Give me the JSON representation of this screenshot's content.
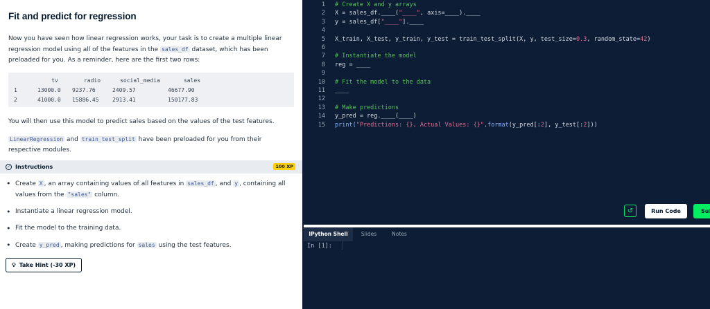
{
  "exercise": {
    "title": "Fit and predict for regression",
    "intro_before_code": "Now you have seen how linear regression works, your task is to create a multiple linear regression model using all of the features in the ",
    "intro_code": "sales_df",
    "intro_after_code": " dataset, which has been preloaded for you. As a reminder, here are the first two rows:",
    "table": {
      "headers": [
        "",
        "tv",
        "radio",
        "social_media",
        "sales"
      ],
      "rows": [
        [
          "1",
          "13000.0",
          "9237.76",
          "2409.57",
          "46677.90"
        ],
        [
          "2",
          "41000.0",
          "15886.45",
          "2913.41",
          "150177.83"
        ]
      ]
    },
    "para2": "You will then use this model to predict sales based on the values of the test features.",
    "para3_code1": "LinearRegression",
    "para3_mid": " and ",
    "para3_code2": "train_test_split",
    "para3_after": " have been preloaded for you from their respective modules."
  },
  "instructions": {
    "label": "Instructions",
    "xp": "100 XP",
    "items": [
      {
        "a": "Create ",
        "c1": "X",
        "b": ", an array containing values of all features in ",
        "c2": "sales_df",
        "c": ", and ",
        "c3": "y",
        "d": ", containing all values from the ",
        "c4": "\"sales\"",
        "e": " column."
      },
      {
        "a": "Instantiate a linear regression model."
      },
      {
        "a": "Fit the model to the training data."
      },
      {
        "a": "Create ",
        "c1": "y_pred",
        "b": ", making predictions for ",
        "c2": "sales",
        "c": " using the test features."
      }
    ],
    "hint_label": "Take Hint (-30 XP)"
  },
  "editor": {
    "lines": [
      {
        "n": "1",
        "parts": [
          {
            "t": "# Create X and y arrays",
            "k": "cm"
          }
        ]
      },
      {
        "n": "2",
        "parts": [
          {
            "t": "X = sales_df.____(",
            "k": ""
          },
          {
            "t": "\"____\"",
            "k": "str"
          },
          {
            "t": ", axis=____).____",
            "k": ""
          }
        ]
      },
      {
        "n": "3",
        "parts": [
          {
            "t": "y = sales_df[",
            "k": ""
          },
          {
            "t": "\"____\"",
            "k": "str"
          },
          {
            "t": "].____",
            "k": ""
          }
        ]
      },
      {
        "n": "4",
        "parts": []
      },
      {
        "n": "5",
        "parts": [
          {
            "t": "X_train, X_test, y_train, y_test = train_test_split(X, y, test_size=",
            "k": ""
          },
          {
            "t": "0.3",
            "k": "num"
          },
          {
            "t": ", random_state=",
            "k": ""
          },
          {
            "t": "42",
            "k": "num"
          },
          {
            "t": ")",
            "k": ""
          }
        ]
      },
      {
        "n": "6",
        "parts": []
      },
      {
        "n": "7",
        "parts": [
          {
            "t": "# Instantiate the model",
            "k": "cm"
          }
        ]
      },
      {
        "n": "8",
        "parts": [
          {
            "t": "reg = ____",
            "k": ""
          }
        ]
      },
      {
        "n": "9",
        "parts": []
      },
      {
        "n": "10",
        "parts": [
          {
            "t": "# Fit the model to the data",
            "k": "cm"
          }
        ]
      },
      {
        "n": "11",
        "parts": [
          {
            "t": "____",
            "k": ""
          }
        ]
      },
      {
        "n": "12",
        "parts": []
      },
      {
        "n": "13",
        "parts": [
          {
            "t": "# Make predictions",
            "k": "cm"
          }
        ]
      },
      {
        "n": "14",
        "parts": [
          {
            "t": "y_pred = reg.____(____)",
            "k": ""
          }
        ]
      },
      {
        "n": "15",
        "parts": [
          {
            "t": "print(",
            "k": "fn"
          },
          {
            "t": "\"Predictions: {}, Actual Values: {}\"",
            "k": "str"
          },
          {
            "t": ".",
            "k": ""
          },
          {
            "t": "format",
            "k": "fn"
          },
          {
            "t": "(y_pred[:",
            "k": ""
          },
          {
            "t": "2",
            "k": "num"
          },
          {
            "t": "], y_test[:",
            "k": ""
          },
          {
            "t": "2",
            "k": "num"
          },
          {
            "t": "]))",
            "k": ""
          }
        ]
      }
    ],
    "reset_icon": "reset-icon",
    "run_label": "Run Code",
    "submit_label": "Sub"
  },
  "console": {
    "tabs": [
      "IPython Shell",
      "Slides",
      "Notes"
    ],
    "active_tab": "IPython Shell",
    "prompt": "In [1]:"
  },
  "colors": {
    "accent_green": "#03ef62",
    "xp_yellow": "#fcce0d",
    "dark_bg": "#0d1d36",
    "comment": "#57c058",
    "string": "#e06e8f"
  }
}
